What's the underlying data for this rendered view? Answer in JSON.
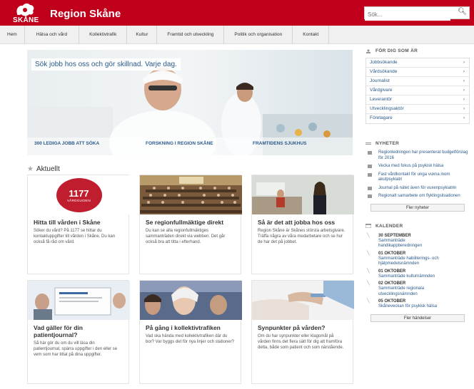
{
  "header": {
    "logo_text": "SKÅNE",
    "title": "Region Skåne",
    "search_placeholder": "Sök..."
  },
  "nav": [
    "Hem",
    "Hälsa och vård",
    "Kollektivtrafik",
    "Kultur",
    "Framtid och utveckling",
    "Politik och organisation",
    "Kontakt"
  ],
  "hero": {
    "caption": "Sök jobb hos oss och gör skillnad. Varje dag.",
    "links": [
      "300 LEDIGA JOBB ATT SÖKA",
      "FORSKNING I REGION SKÅNE",
      "FRAMTIDENS SJUKHUS"
    ]
  },
  "aktuellt": {
    "heading": "Aktuellt"
  },
  "cards": [
    {
      "title": "Hitta till vården i Skåne",
      "text": "Söker du vård? På 1177 se hittar du kontaktuppgifter till vården i Skåne. Du kan också få råd om vård.",
      "badge": "1177",
      "badge_sub": "VÅRDGUIDEN"
    },
    {
      "title": "Se regionfullmäktige direkt",
      "text": "Du kan se alla regionfullmäktiges sammanträden direkt via webben. Det går också bra att titta i efterhand."
    },
    {
      "title": "Så är det att jobba hos oss",
      "text": "Region Skåne är Skånes största arbetsgivare. Träffa några av våra medarbetare och se hur de har det på jobbet."
    },
    {
      "title": "Vad gäller för din patientjournal?",
      "text": "Så här gör du om du vill läsa din patientjournal, spärra uppgifter i den eller se vem som har tittat på dina uppgifter."
    },
    {
      "title": "På gång i kollektivtrafiken",
      "text": "Vad ska hända med kollektivtrafiken där du bor? Var byggs det för nya linjer och stationer?"
    },
    {
      "title": "Synpunkter på vården?",
      "text": "Om du har synpunkter eller klagomål på vården finns det flera sätt för dig att framföra detta, både som patient och som närstående."
    }
  ],
  "sidebar": {
    "roles_heading": "FÖR DIG SOM ÄR",
    "roles": [
      "Jobbsökande",
      "Vårdsökande",
      "Journalist",
      "Vårdgivare",
      "Leverantör",
      "Utvecklingsaktör",
      "Företagare"
    ],
    "news_heading": "NYHETER",
    "news": [
      "Regionledningen har presenterat budgetförslag för 2016",
      "Vecka med fokus på psykisk hälsa",
      "Fast vårdkontakt för unga vuxna inom akutpsykiatri",
      "Journal på nätet även för vuxenpsykiatrin",
      "Regionalt samarbete om flyktingsituationen"
    ],
    "news_button": "Fler nyheter",
    "calendar_heading": "KALENDER",
    "calendar": [
      {
        "date": "30 SEPTEMBER",
        "text": "Sammanträde handikappberedningen"
      },
      {
        "date": "01 OKTOBER",
        "text": "Sammanträde habiliterings- och hjälpmedelsnämnden"
      },
      {
        "date": "01 OKTOBER",
        "text": "Sammanträde kulturnämnden"
      },
      {
        "date": "02 OKTOBER",
        "text": "Sammanträde regionala utvecklingsnämnden"
      },
      {
        "date": "05 OKTOBER",
        "text": "Skåneveckan för psykisk hälsa"
      }
    ],
    "calendar_button": "Fler händelser"
  }
}
